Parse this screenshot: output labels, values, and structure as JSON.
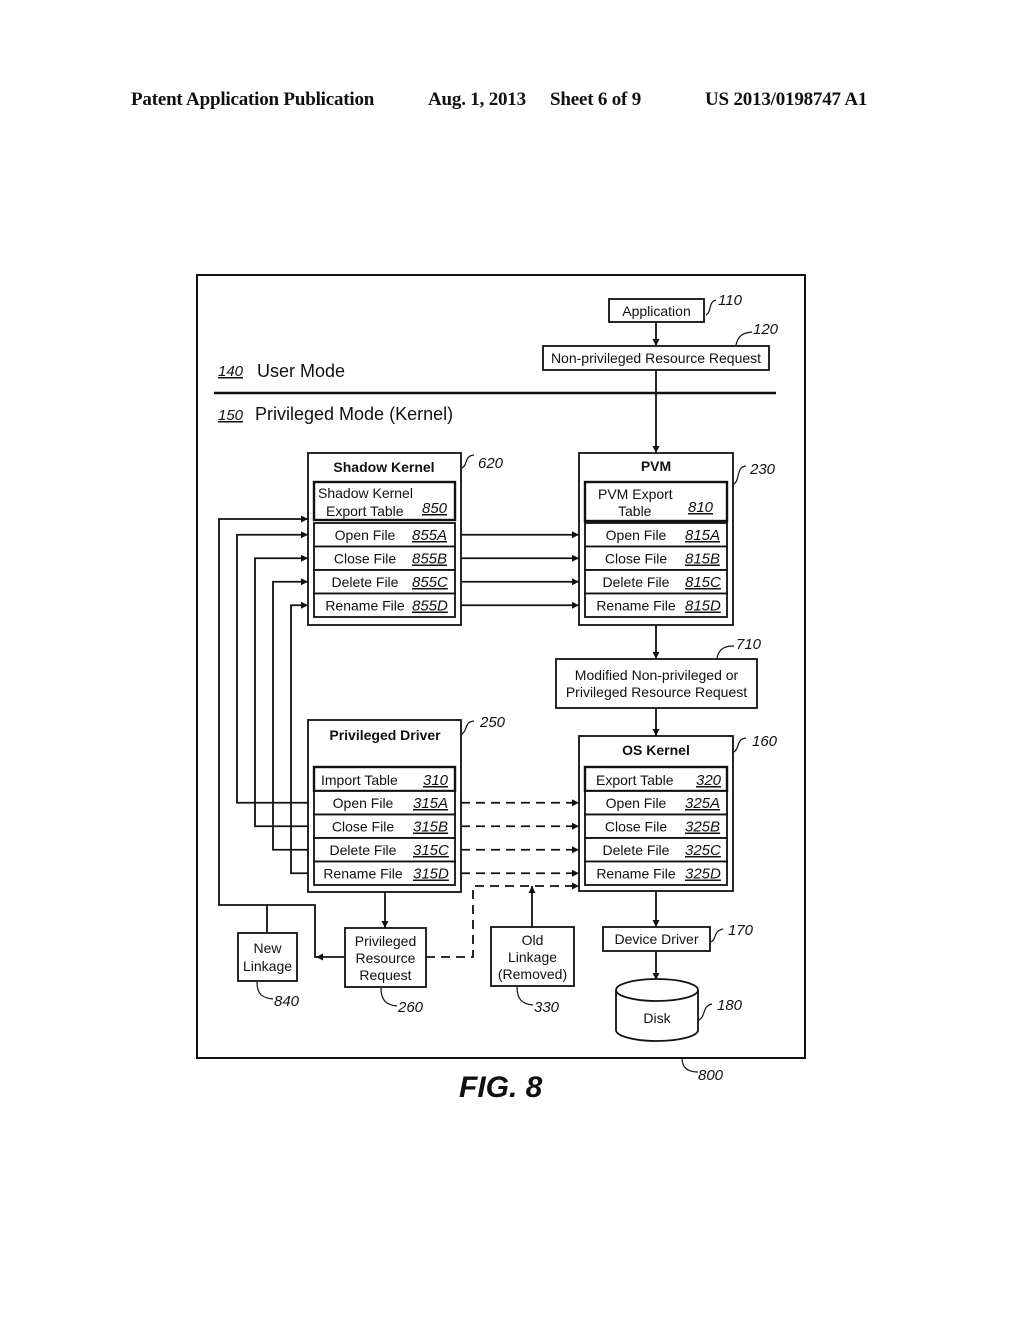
{
  "header": {
    "left": "Patent Application Publication",
    "date": "Aug. 1, 2013",
    "sheet": "Sheet 6 of 9",
    "number": "US 2013/0198747 A1"
  },
  "figure": {
    "caption": "FIG. 8",
    "frame_ref": "800"
  },
  "modes": {
    "user": {
      "ref": "140",
      "label": "User Mode"
    },
    "kernel": {
      "ref": "150",
      "label": "Privileged Mode (Kernel)"
    }
  },
  "nodes": {
    "application": {
      "label": "Application",
      "ref": "110"
    },
    "nonpriv_request": {
      "label": "Non-privileged Resource Request",
      "ref": "120"
    },
    "modified_request": {
      "line1": "Modified Non-privileged or",
      "line2": "Privileged Resource Request",
      "ref": "710"
    },
    "device_driver": {
      "label": "Device Driver",
      "ref": "170"
    },
    "disk": {
      "label": "Disk",
      "ref": "180"
    },
    "new_linkage": {
      "line1": "New",
      "line2": "Linkage",
      "ref": "840"
    },
    "priv_request": {
      "line1": "Privileged",
      "line2": "Resource",
      "line3": "Request",
      "ref": "260"
    },
    "old_linkage": {
      "line1": "Old",
      "line2": "Linkage",
      "line3": "(Removed)",
      "ref": "330"
    }
  },
  "tables": {
    "shadow_kernel": {
      "title": "Shadow Kernel",
      "ref": "620",
      "header_line1": "Shadow Kernel",
      "header_line2": "Export Table",
      "header_ref": "850",
      "rows": [
        {
          "label": "Open File",
          "ref": "855A"
        },
        {
          "label": "Close File",
          "ref": "855B"
        },
        {
          "label": "Delete File",
          "ref": "855C"
        },
        {
          "label": "Rename File",
          "ref": "855D"
        }
      ]
    },
    "pvm": {
      "title": "PVM",
      "ref": "230",
      "header_line1": "PVM Export",
      "header_line2": "Table",
      "header_ref": "810",
      "rows": [
        {
          "label": "Open File",
          "ref": "815A"
        },
        {
          "label": "Close File",
          "ref": "815B"
        },
        {
          "label": "Delete File",
          "ref": "815C"
        },
        {
          "label": "Rename File",
          "ref": "815D"
        }
      ]
    },
    "privileged_driver": {
      "title": "Privileged Driver",
      "ref": "250",
      "header_line1": "Import Table",
      "header_ref": "310",
      "rows": [
        {
          "label": "Open File",
          "ref": "315A"
        },
        {
          "label": "Close File",
          "ref": "315B"
        },
        {
          "label": "Delete File",
          "ref": "315C"
        },
        {
          "label": "Rename File",
          "ref": "315D"
        }
      ]
    },
    "os_kernel": {
      "title": "OS Kernel",
      "ref": "160",
      "header_line1": "Export Table",
      "header_ref": "320",
      "rows": [
        {
          "label": "Open File",
          "ref": "325A"
        },
        {
          "label": "Close File",
          "ref": "325B"
        },
        {
          "label": "Delete File",
          "ref": "325C"
        },
        {
          "label": "Rename File",
          "ref": "325D"
        }
      ]
    }
  }
}
